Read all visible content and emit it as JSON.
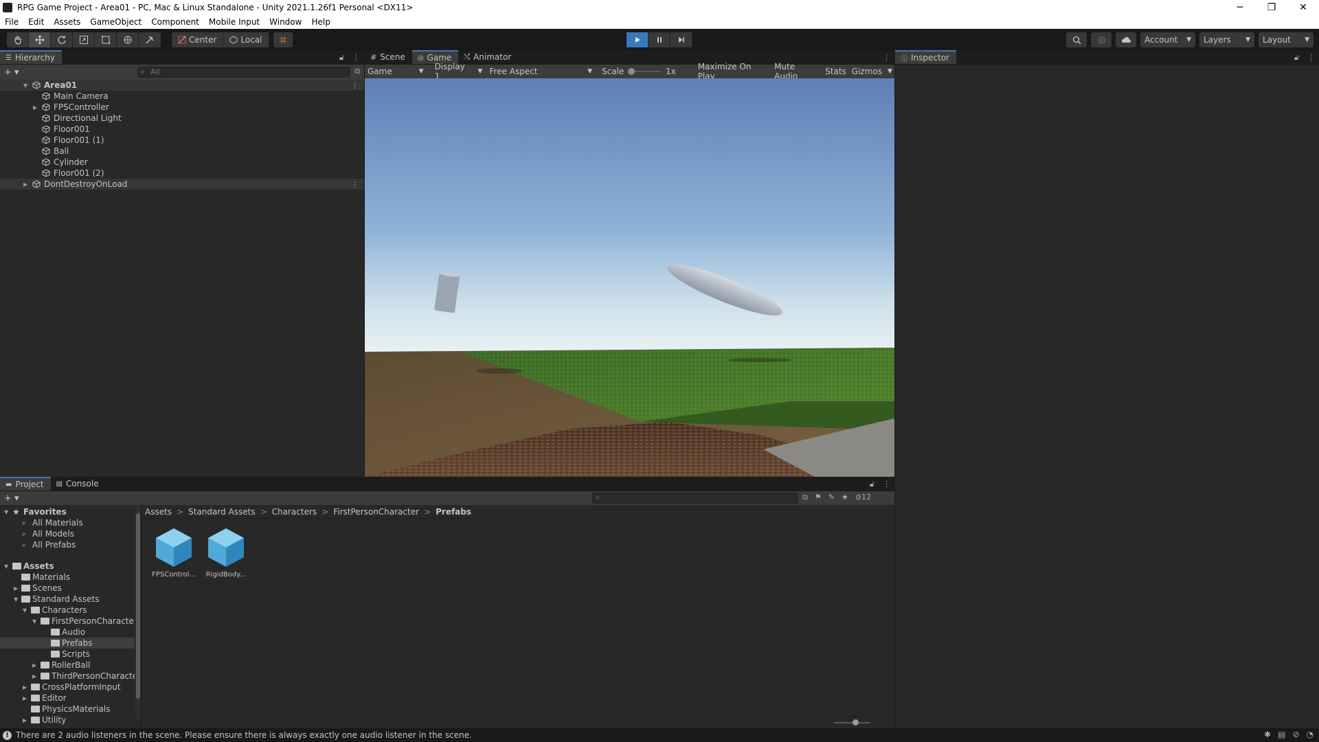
{
  "window": {
    "title": "RPG Game Project - Area01 - PC, Mac & Linux Standalone - Unity 2021.1.26f1 Personal <DX11>",
    "minimize": "─",
    "restore": "❐",
    "close": "✕"
  },
  "menu": [
    "File",
    "Edit",
    "Assets",
    "GameObject",
    "Component",
    "Mobile Input",
    "Window",
    "Help"
  ],
  "toolbar": {
    "pivot_center": "Center",
    "pivot_local": "Local",
    "account": "Account",
    "layers": "Layers",
    "layout": "Layout"
  },
  "hierarchy": {
    "tab": "Hierarchy",
    "search_placeholder": "All",
    "items": [
      {
        "label": "Area01",
        "kind": "scene",
        "expanded": true
      },
      {
        "label": "Main Camera"
      },
      {
        "label": "FPSController",
        "collapsed": true
      },
      {
        "label": "Directional Light"
      },
      {
        "label": "Floor001"
      },
      {
        "label": "Floor001 (1)"
      },
      {
        "label": "Ball"
      },
      {
        "label": "Cylinder"
      },
      {
        "label": "Floor001 (2)"
      },
      {
        "label": "DontDestroyOnLoad",
        "kind": "scene",
        "expanded": false
      }
    ]
  },
  "game_view": {
    "tabs": [
      "Scene",
      "Game",
      "Animator"
    ],
    "active_tab": "Game",
    "mode": "Game",
    "display": "Display 1",
    "aspect": "Free Aspect",
    "scale_label": "Scale",
    "scale_value": "1x",
    "maximize": "Maximize On Play",
    "mute": "Mute Audio",
    "stats": "Stats",
    "gizmos": "Gizmos"
  },
  "inspector": {
    "tab": "Inspector"
  },
  "project": {
    "tabs": [
      "Project",
      "Console"
    ],
    "hidden_count": "12",
    "breadcrumb": [
      "Assets",
      "Standard Assets",
      "Characters",
      "FirstPersonCharacter",
      "Prefabs"
    ],
    "tree": [
      {
        "label": "Favorites"
      },
      {
        "label": "All Materials"
      },
      {
        "label": "All Models"
      },
      {
        "label": "All Prefabs"
      },
      {
        "label": "Assets"
      },
      {
        "label": "Materials"
      },
      {
        "label": "Scenes"
      },
      {
        "label": "Standard Assets"
      },
      {
        "label": "Characters"
      },
      {
        "label": "FirstPersonCharacter"
      },
      {
        "label": "Audio"
      },
      {
        "label": "Prefabs"
      },
      {
        "label": "Scripts"
      },
      {
        "label": "RollerBall"
      },
      {
        "label": "ThirdPersonCharacter"
      },
      {
        "label": "CrossPlatformInput"
      },
      {
        "label": "Editor"
      },
      {
        "label": "PhysicsMaterials"
      },
      {
        "label": "Utility"
      }
    ],
    "assets": [
      "FPSControl...",
      "RigidBody..."
    ]
  },
  "status": {
    "message": "There are 2 audio listeners in the scene. Please ensure there is always exactly one audio listener in the scene."
  },
  "colors": {
    "accent": "#3a79bb",
    "panel": "#282828",
    "panel_header": "#3c3c3c",
    "prefab_blue": "#4fa9d9"
  }
}
